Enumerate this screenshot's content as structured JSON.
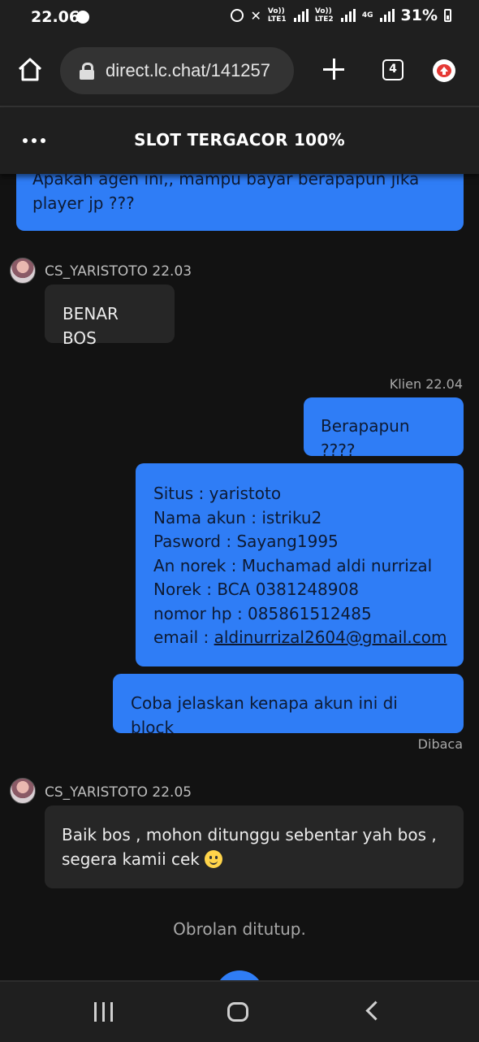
{
  "status_bar": {
    "time": "22.06",
    "net1": "Vo)) LTE1",
    "net2": "Vo)) LTE2",
    "net3": "4G",
    "battery": "31%"
  },
  "browser": {
    "url": "direct.lc.chat/141257",
    "tab_count": "4"
  },
  "chat": {
    "title": "SLOT TERGACOR 100%",
    "messages": [
      {
        "from": "me",
        "lines": [
          "Apakah agen ini,, mampu bayar berapapun jika",
          "player jp ???"
        ]
      },
      {
        "from": "agent",
        "sender": "CS_YARISTOTO 22.03",
        "lines": [
          "BENAR BOS"
        ]
      },
      {
        "from": "me",
        "meta": "Klien 22.04",
        "lines": [
          "Berapapun ????"
        ]
      },
      {
        "from": "me",
        "lines": [
          "Situs : yaristoto",
          "Nama akun : istriku2",
          "Pasword : Sayang1995",
          "An norek : Muchamad aldi nurrizal",
          "Norek : BCA 0381248908",
          "nomor hp : 085861512485"
        ],
        "email_prefix": "email : ",
        "email": "aldinurrizal2604@gmail.com"
      },
      {
        "from": "me",
        "lines": [
          "Coba jelaskan kenapa akun ini di block"
        ],
        "status": "Dibaca"
      },
      {
        "from": "agent",
        "sender": "CS_YARISTOTO 22.05",
        "lines": [
          "Baik bos , mohon ditunggu sebentar yah bos ,",
          "segera kamii cek"
        ],
        "emoji": "slightly-smiling-face"
      }
    ],
    "closed_note": "Obrolan ditutup."
  },
  "colors": {
    "background": "#121212",
    "bar": "#1f1f1f",
    "my_bubble": "#2f7df6",
    "agent_bubble": "#262626"
  }
}
